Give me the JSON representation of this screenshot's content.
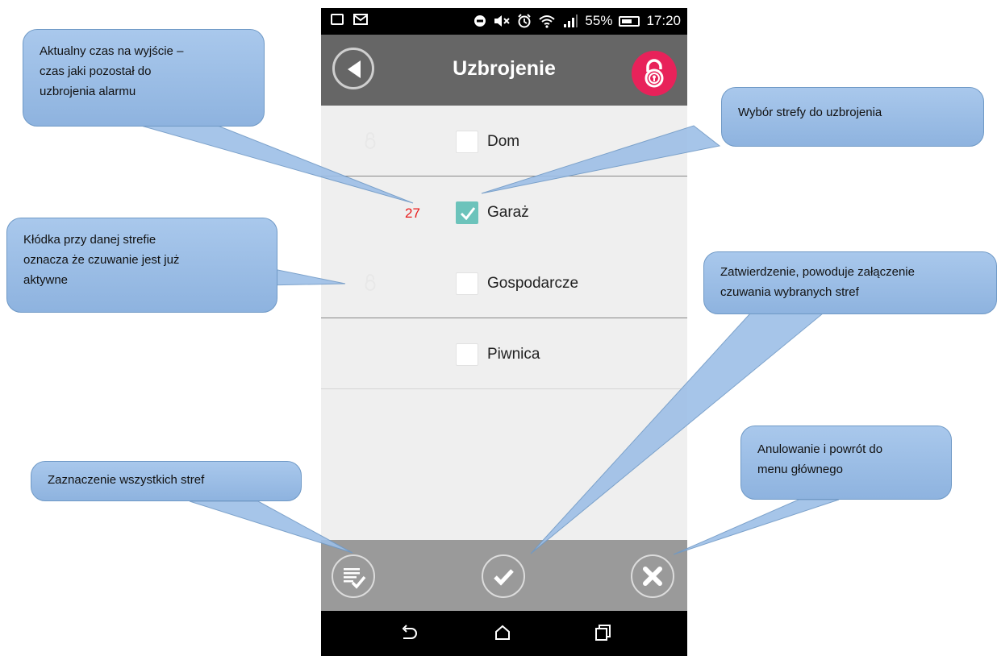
{
  "status_bar": {
    "battery": "55%",
    "time": "17:20"
  },
  "app": {
    "title": "Uzbrojenie"
  },
  "zones": [
    {
      "name": "Dom",
      "checked": false,
      "armed": true,
      "timer": ""
    },
    {
      "name": "Garaż",
      "checked": true,
      "armed": false,
      "timer": "27"
    },
    {
      "name": "Gospodarcze",
      "checked": false,
      "armed": true,
      "timer": ""
    },
    {
      "name": "Piwnica",
      "checked": false,
      "armed": false,
      "timer": ""
    }
  ],
  "callouts": {
    "exit_time": "Aktualny czas na wyjście –\nczas jaki pozostał do\nuzbrojenia alarmu",
    "zone_select": "Wybór strefy do uzbrojenia",
    "padlock": "Kłódka przy danej strefie\noznacza że czuwanie jest już\naktywne",
    "confirm": "Zatwierdzenie, powoduje załączenie\nczuwania wybranych stref",
    "select_all": "Zaznaczenie wszystkich stref",
    "cancel": "Anulowanie i powrót do\nmenu głównego"
  },
  "icons": {
    "status_left": [
      "notification-icon",
      "mail-icon"
    ],
    "status_right": [
      "dnd-icon",
      "mute-icon",
      "alarm-icon",
      "wifi-icon",
      "signal-icon",
      "battery-icon"
    ],
    "appbar": [
      "back-icon",
      "lock-icon"
    ],
    "bottom": [
      "select-all-icon",
      "check-icon",
      "close-icon"
    ],
    "nav": [
      "nav-back-icon",
      "nav-home-icon",
      "nav-recents-icon"
    ]
  },
  "colors": {
    "appbar": "#666666",
    "lock_button": "#e8225a",
    "checkbox_checked": "#6cc3bb",
    "timer": "#e81a1a",
    "callout": "#9dbfe7"
  }
}
